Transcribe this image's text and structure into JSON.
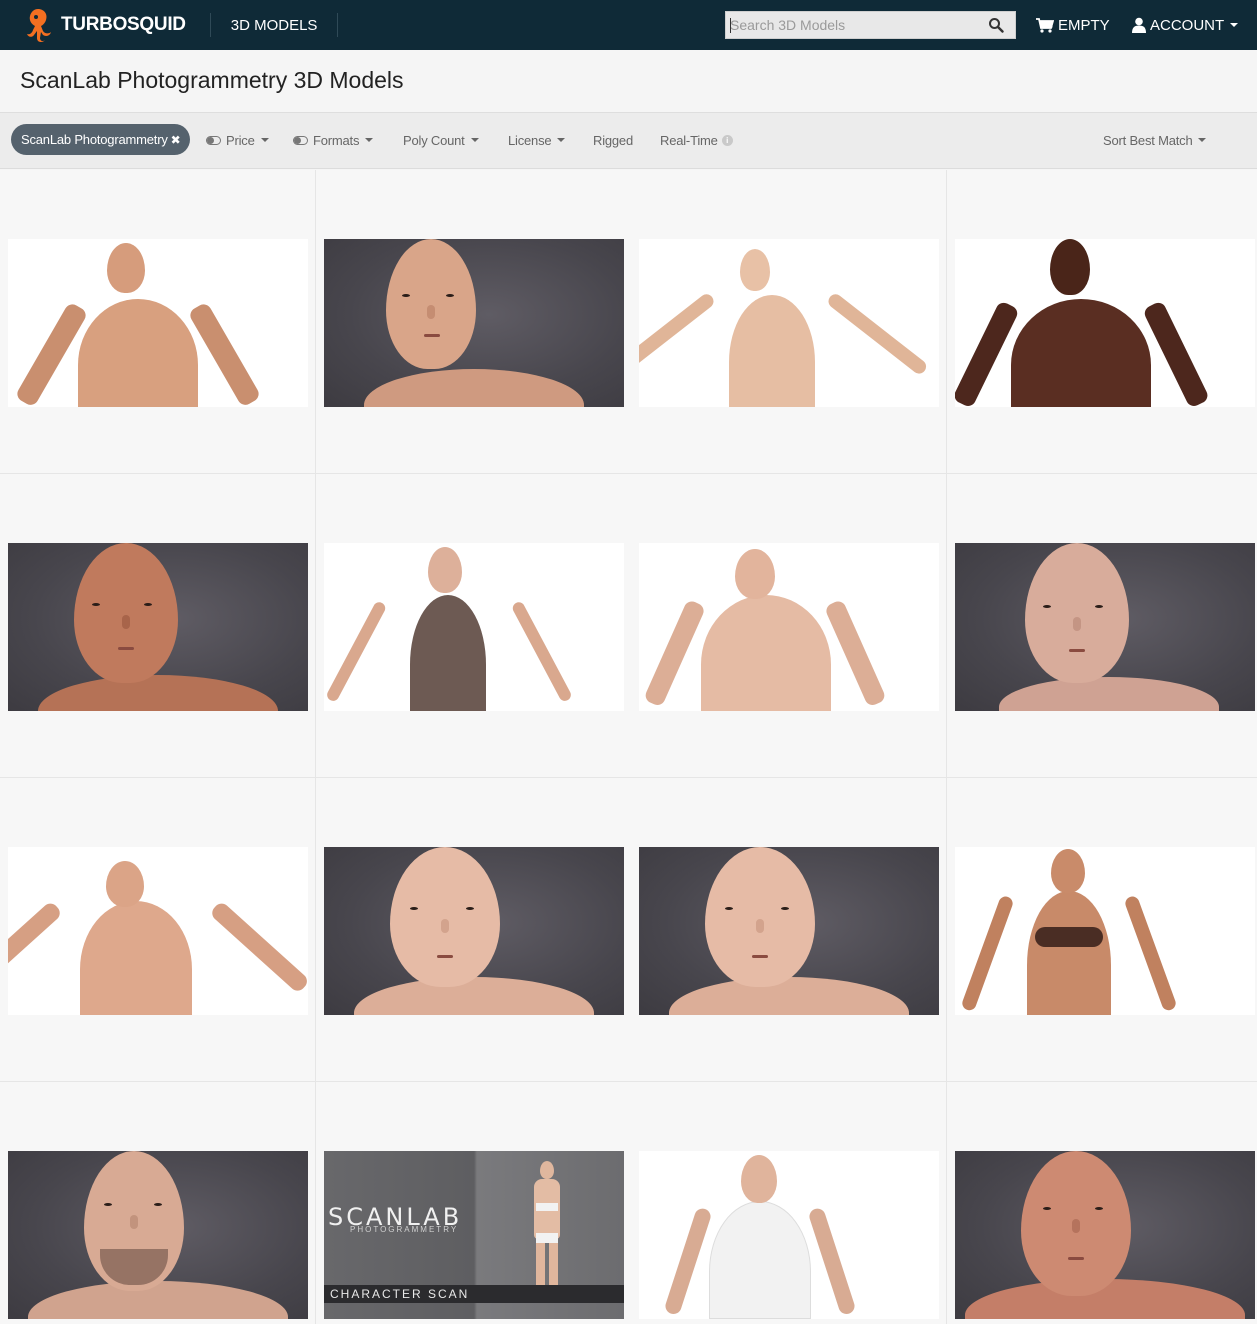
{
  "nav": {
    "brand": "TURBOSQUID",
    "models_link": "3D MODELS",
    "search_placeholder": "Search 3D Models",
    "cart_label": "EMPTY",
    "account_label": "ACCOUNT"
  },
  "page": {
    "title": "ScanLab Photogrammetry 3D Models"
  },
  "filters": {
    "active_chip": "ScanLab Photogrammetry",
    "price": "Price",
    "formats": "Formats",
    "poly_count": "Poly Count",
    "license": "License",
    "rigged": "Rigged",
    "real_time": "Real-Time",
    "sort": "Sort Best Match"
  },
  "thumbnail_card": {
    "logo_text": "SCANLAB",
    "logo_sub": "PHOTOGRAMMETRY",
    "banner": "CHARACTER SCAN"
  },
  "colors": {
    "navbar": "#0f2a37",
    "chip": "#55626d",
    "logo_orange": "#f36f21"
  }
}
